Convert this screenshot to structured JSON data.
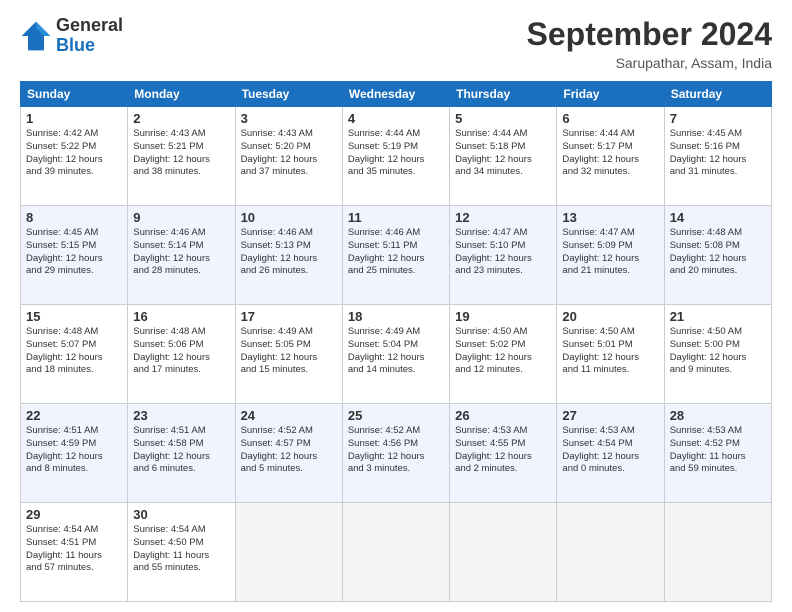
{
  "logo": {
    "general": "General",
    "blue": "Blue"
  },
  "title": "September 2024",
  "location": "Sarupathar, Assam, India",
  "days_of_week": [
    "Sunday",
    "Monday",
    "Tuesday",
    "Wednesday",
    "Thursday",
    "Friday",
    "Saturday"
  ],
  "weeks": [
    {
      "row_class": "row-white",
      "days": [
        {
          "number": "1",
          "info": "Sunrise: 4:42 AM\nSunset: 5:22 PM\nDaylight: 12 hours\nand 39 minutes."
        },
        {
          "number": "2",
          "info": "Sunrise: 4:43 AM\nSunset: 5:21 PM\nDaylight: 12 hours\nand 38 minutes."
        },
        {
          "number": "3",
          "info": "Sunrise: 4:43 AM\nSunset: 5:20 PM\nDaylight: 12 hours\nand 37 minutes."
        },
        {
          "number": "4",
          "info": "Sunrise: 4:44 AM\nSunset: 5:19 PM\nDaylight: 12 hours\nand 35 minutes."
        },
        {
          "number": "5",
          "info": "Sunrise: 4:44 AM\nSunset: 5:18 PM\nDaylight: 12 hours\nand 34 minutes."
        },
        {
          "number": "6",
          "info": "Sunrise: 4:44 AM\nSunset: 5:17 PM\nDaylight: 12 hours\nand 32 minutes."
        },
        {
          "number": "7",
          "info": "Sunrise: 4:45 AM\nSunset: 5:16 PM\nDaylight: 12 hours\nand 31 minutes."
        }
      ]
    },
    {
      "row_class": "row-alt",
      "days": [
        {
          "number": "8",
          "info": "Sunrise: 4:45 AM\nSunset: 5:15 PM\nDaylight: 12 hours\nand 29 minutes."
        },
        {
          "number": "9",
          "info": "Sunrise: 4:46 AM\nSunset: 5:14 PM\nDaylight: 12 hours\nand 28 minutes."
        },
        {
          "number": "10",
          "info": "Sunrise: 4:46 AM\nSunset: 5:13 PM\nDaylight: 12 hours\nand 26 minutes."
        },
        {
          "number": "11",
          "info": "Sunrise: 4:46 AM\nSunset: 5:11 PM\nDaylight: 12 hours\nand 25 minutes."
        },
        {
          "number": "12",
          "info": "Sunrise: 4:47 AM\nSunset: 5:10 PM\nDaylight: 12 hours\nand 23 minutes."
        },
        {
          "number": "13",
          "info": "Sunrise: 4:47 AM\nSunset: 5:09 PM\nDaylight: 12 hours\nand 21 minutes."
        },
        {
          "number": "14",
          "info": "Sunrise: 4:48 AM\nSunset: 5:08 PM\nDaylight: 12 hours\nand 20 minutes."
        }
      ]
    },
    {
      "row_class": "row-white",
      "days": [
        {
          "number": "15",
          "info": "Sunrise: 4:48 AM\nSunset: 5:07 PM\nDaylight: 12 hours\nand 18 minutes."
        },
        {
          "number": "16",
          "info": "Sunrise: 4:48 AM\nSunset: 5:06 PM\nDaylight: 12 hours\nand 17 minutes."
        },
        {
          "number": "17",
          "info": "Sunrise: 4:49 AM\nSunset: 5:05 PM\nDaylight: 12 hours\nand 15 minutes."
        },
        {
          "number": "18",
          "info": "Sunrise: 4:49 AM\nSunset: 5:04 PM\nDaylight: 12 hours\nand 14 minutes."
        },
        {
          "number": "19",
          "info": "Sunrise: 4:50 AM\nSunset: 5:02 PM\nDaylight: 12 hours\nand 12 minutes."
        },
        {
          "number": "20",
          "info": "Sunrise: 4:50 AM\nSunset: 5:01 PM\nDaylight: 12 hours\nand 11 minutes."
        },
        {
          "number": "21",
          "info": "Sunrise: 4:50 AM\nSunset: 5:00 PM\nDaylight: 12 hours\nand 9 minutes."
        }
      ]
    },
    {
      "row_class": "row-alt",
      "days": [
        {
          "number": "22",
          "info": "Sunrise: 4:51 AM\nSunset: 4:59 PM\nDaylight: 12 hours\nand 8 minutes."
        },
        {
          "number": "23",
          "info": "Sunrise: 4:51 AM\nSunset: 4:58 PM\nDaylight: 12 hours\nand 6 minutes."
        },
        {
          "number": "24",
          "info": "Sunrise: 4:52 AM\nSunset: 4:57 PM\nDaylight: 12 hours\nand 5 minutes."
        },
        {
          "number": "25",
          "info": "Sunrise: 4:52 AM\nSunset: 4:56 PM\nDaylight: 12 hours\nand 3 minutes."
        },
        {
          "number": "26",
          "info": "Sunrise: 4:53 AM\nSunset: 4:55 PM\nDaylight: 12 hours\nand 2 minutes."
        },
        {
          "number": "27",
          "info": "Sunrise: 4:53 AM\nSunset: 4:54 PM\nDaylight: 12 hours\nand 0 minutes."
        },
        {
          "number": "28",
          "info": "Sunrise: 4:53 AM\nSunset: 4:52 PM\nDaylight: 11 hours\nand 59 minutes."
        }
      ]
    },
    {
      "row_class": "row-white",
      "days": [
        {
          "number": "29",
          "info": "Sunrise: 4:54 AM\nSunset: 4:51 PM\nDaylight: 11 hours\nand 57 minutes."
        },
        {
          "number": "30",
          "info": "Sunrise: 4:54 AM\nSunset: 4:50 PM\nDaylight: 11 hours\nand 55 minutes."
        },
        {
          "number": "",
          "info": ""
        },
        {
          "number": "",
          "info": ""
        },
        {
          "number": "",
          "info": ""
        },
        {
          "number": "",
          "info": ""
        },
        {
          "number": "",
          "info": ""
        }
      ]
    }
  ]
}
